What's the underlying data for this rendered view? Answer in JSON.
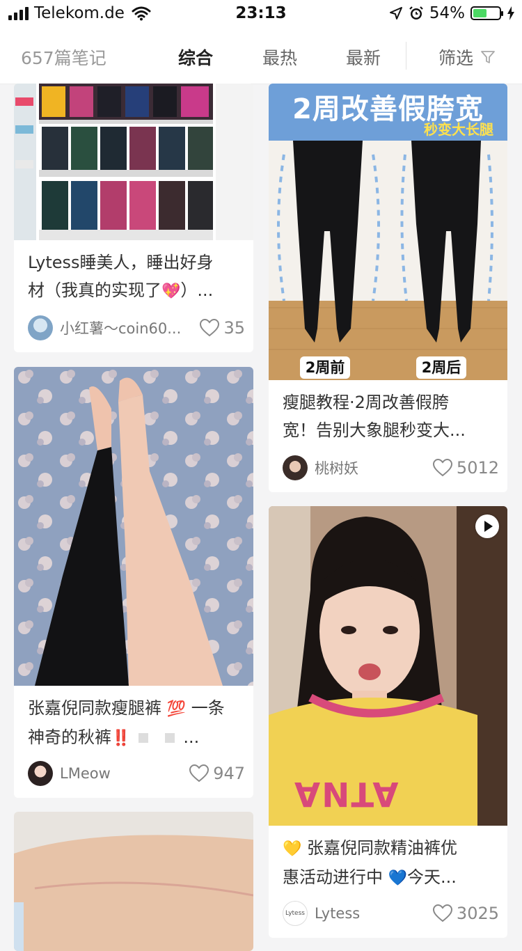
{
  "status": {
    "carrier": "Telekom.de",
    "time": "23:13",
    "battery": "54%",
    "battery_level": 0.54
  },
  "filter_bar": {
    "note_count": "657篇笔记",
    "tabs": [
      {
        "label": "综合",
        "active": true
      },
      {
        "label": "最热",
        "active": false
      },
      {
        "label": "最新",
        "active": false
      }
    ],
    "filter_label": "筛选"
  },
  "cards": [
    {
      "title_line1": "Lytess睡美人，睡出好身",
      "title_line2": "材（我真的实现了",
      "title_emoji": "💖",
      "title_tail": "）...",
      "author": "小红薯～coin60...",
      "likes": "35"
    },
    {
      "image_text": "2周改善假胯宽",
      "image_badge": "秒变大长腿",
      "label_before": "2周前",
      "label_after": "2周后",
      "title_line1": "瘦腿教程·2周改善假胯",
      "title_line2": "宽！告别大象腿秒变大...",
      "author": "桃树妖",
      "likes": "5012"
    },
    {
      "title_line1_a": "张嘉倪同款瘦腿裤",
      "title_line1_emoji": "💯",
      "title_line1_b": "一条",
      "title_line2": "神奇的秋裤",
      "title_line2_emoji": "‼️",
      "title_line2_tail": "...",
      "author": "LMeow",
      "likes": "947"
    },
    {
      "image_shirt_text": "ATNA",
      "title_line1_emoji": "💛",
      "title_line1": "张嘉倪同款精油裤优",
      "title_line2": "惠活动进行中",
      "title_line2_emoji": "💙",
      "title_line2_tail": "今天...",
      "author": "Lytess",
      "avatar_text": "Lytess",
      "likes": "3025"
    },
    {}
  ],
  "icons": [
    "signal-icon",
    "wifi-icon",
    "location-icon",
    "alarm-icon",
    "battery-icon",
    "filter-icon",
    "heart-icon",
    "play-icon"
  ]
}
